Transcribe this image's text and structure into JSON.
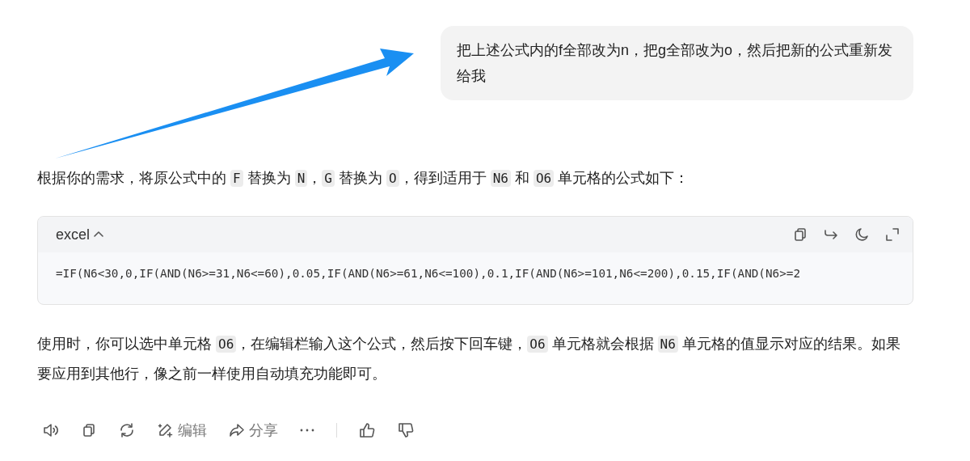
{
  "user_message": {
    "text": "把上述公式内的f全部改为n，把g全部改为o，然后把新的公式重新发给我"
  },
  "response": {
    "paragraphs": [
      {
        "segments": [
          {
            "kind": "text",
            "text": "根据你的需求，将原公式中的 "
          },
          {
            "kind": "code",
            "text": "F"
          },
          {
            "kind": "text",
            "text": " 替换为 "
          },
          {
            "kind": "code",
            "text": "N"
          },
          {
            "kind": "text",
            "text": "，"
          },
          {
            "kind": "code",
            "text": "G"
          },
          {
            "kind": "text",
            "text": " 替换为 "
          },
          {
            "kind": "code",
            "text": "O"
          },
          {
            "kind": "text",
            "text": "，得到适用于 "
          },
          {
            "kind": "code",
            "text": "N6"
          },
          {
            "kind": "text",
            "text": " 和 "
          },
          {
            "kind": "code",
            "text": "O6"
          },
          {
            "kind": "text",
            "text": " 单元格的公式如下："
          }
        ]
      },
      {
        "segments": [
          {
            "kind": "text",
            "text": "使用时，你可以选中单元格 "
          },
          {
            "kind": "code",
            "text": "O6"
          },
          {
            "kind": "text",
            "text": "，在编辑栏输入这个公式，然后按下回车键，"
          },
          {
            "kind": "code",
            "text": "O6"
          },
          {
            "kind": "text",
            "text": " 单元格就会根据 "
          },
          {
            "kind": "code",
            "text": "N6"
          },
          {
            "kind": "text",
            "text": " 单元格的值显示对应的结果。如果要应用到其他行，像之前一样使用自动填充功能即可。"
          }
        ]
      }
    ],
    "code_block": {
      "language": "excel",
      "expanded": true,
      "code": "=IF(N6<30,0,IF(AND(N6>=31,N6<=60),0.05,IF(AND(N6>=61,N6<=100),0.1,IF(AND(N6>=101,N6<=200),0.15,IF(AND(N6>=2"
    }
  },
  "actions": [
    {
      "kind": "speaker"
    },
    {
      "kind": "copy"
    },
    {
      "kind": "refresh"
    },
    {
      "kind": "edit",
      "label": "编辑"
    },
    {
      "kind": "share",
      "label": "分享"
    },
    {
      "kind": "more"
    },
    {
      "kind": "divider"
    },
    {
      "kind": "like"
    },
    {
      "kind": "dislike"
    }
  ]
}
